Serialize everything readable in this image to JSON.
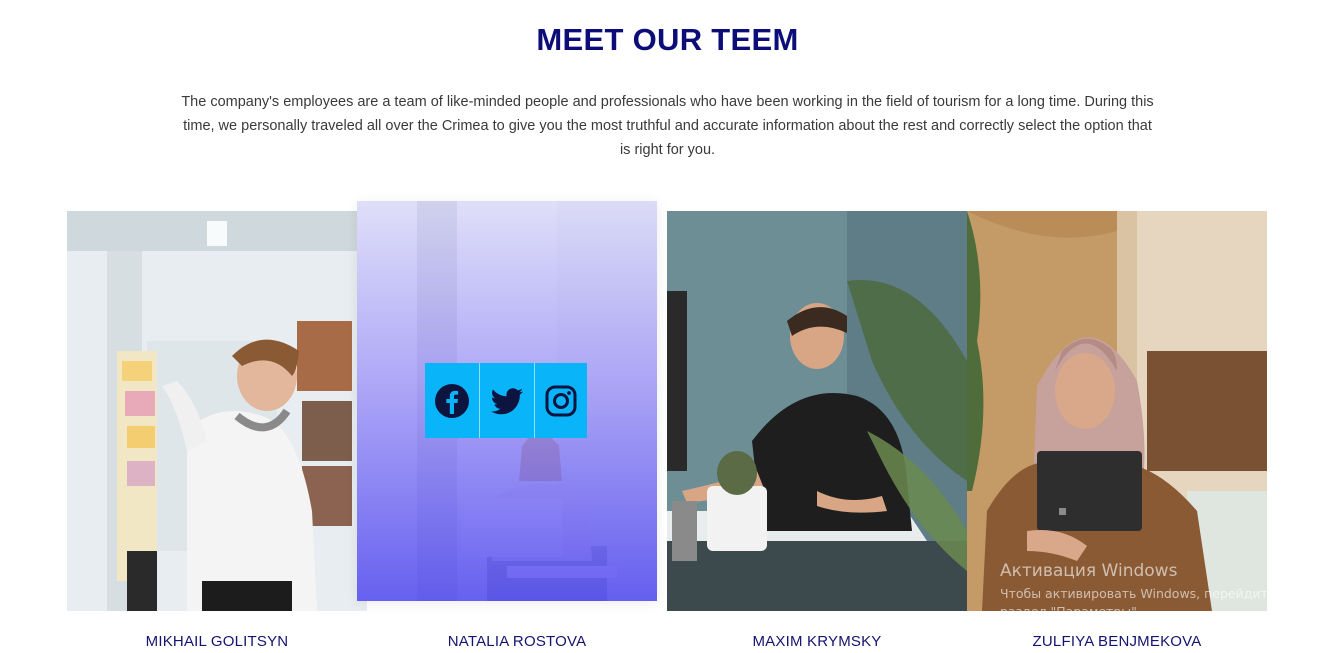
{
  "section": {
    "title": "MEET OUR TEEM",
    "intro": "The company's employees are a team of like-minded people and professionals who have been working in the field of tourism for a long time. During this time, we personally traveled all over the Crimea to give you the most truthful and accurate information about the rest and correctly select the option that is right for you."
  },
  "team": [
    {
      "name": "MIKHAIL GOLITSYN"
    },
    {
      "name": "NATALIA ROSTOVA"
    },
    {
      "name": "MAXIM KRYMSKY"
    },
    {
      "name": "ZULFIYA BENJMEKOVA"
    }
  ],
  "social": [
    {
      "icon": "facebook-icon"
    },
    {
      "icon": "twitter-icon"
    },
    {
      "icon": "instagram-icon"
    }
  ],
  "watermark": {
    "title": "Активация Windows",
    "line1": "Чтобы активировать Windows, перейдите в",
    "line2": "раздел \"Параметры\"."
  },
  "colors": {
    "heading": "#0d0d7a",
    "name": "#141470",
    "social_bg": "#0ab4f8",
    "overlay": "#5048f0"
  }
}
